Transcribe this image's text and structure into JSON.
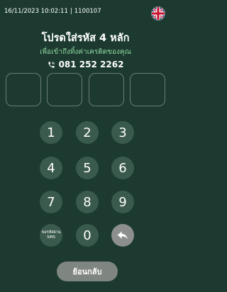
{
  "status_bar": {
    "datetime": "16/11/2023 10:02:11",
    "separator": "|",
    "terminal_id": "1100107"
  },
  "header": {
    "title": "โปรดใส่รหัส 4 หลัก",
    "subtitle": "เพื่อเข้าถึงทิ้งค่าเครดิตของคุณ",
    "phone": "081 252 2262"
  },
  "pin": {
    "length": 4
  },
  "keypad": {
    "keys": [
      "1",
      "2",
      "3",
      "4",
      "5",
      "6",
      "7",
      "8",
      "9"
    ],
    "sms_label_line1": "ขอรหัสผ่าน",
    "sms_label_line2": "SMS",
    "zero": "0"
  },
  "footer": {
    "back_label": "ย้อนกลับ"
  },
  "colors": {
    "background": "#1c3a2f",
    "key": "#3b5a4e",
    "accent_green": "#8ed49f",
    "grey_button": "#7f8581"
  },
  "icons": {
    "language": "uk-flag-icon",
    "phone": "phone-icon",
    "backspace": "backspace-arrow-icon"
  }
}
